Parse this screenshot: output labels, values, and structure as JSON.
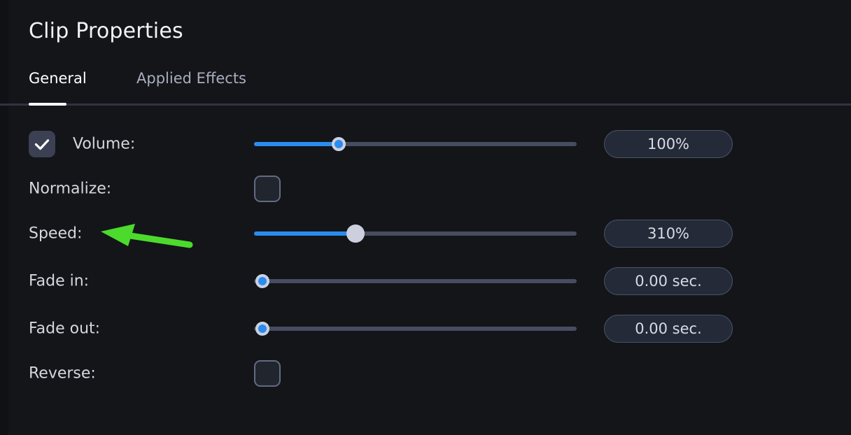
{
  "header": {
    "title": "Clip Properties"
  },
  "tabs": [
    {
      "label": "General",
      "active": true
    },
    {
      "label": "Applied Effects",
      "active": false
    }
  ],
  "rows": [
    {
      "label": "Volume:",
      "control": "slider",
      "checkbox": "checked",
      "slider_percent": 26,
      "value": "100%"
    },
    {
      "label": "Normalize:",
      "control": "checkbox",
      "checkbox": "unchecked"
    },
    {
      "label": "Speed:",
      "control": "slider",
      "slider_percent": 31,
      "value": "310%"
    },
    {
      "label": "Fade in:",
      "control": "slider",
      "slider_percent": 0,
      "value": "0.00 sec."
    },
    {
      "label": "Fade out:",
      "control": "slider",
      "slider_percent": 0,
      "value": "0.00 sec."
    },
    {
      "label": "Reverse:",
      "control": "checkbox",
      "checkbox": "unchecked"
    }
  ],
  "annotation": {
    "color": "#4cdb2c",
    "points_at": "Speed:"
  },
  "colors": {
    "background": "#131519",
    "accent_blue": "#2b8cf0",
    "track": "#464d60",
    "pill_fill": "#242a38",
    "pill_border": "#4b5367",
    "label_text": "#d5d7de",
    "active_tab_text": "#ffffff",
    "inactive_tab_text": "#a9aebd"
  }
}
